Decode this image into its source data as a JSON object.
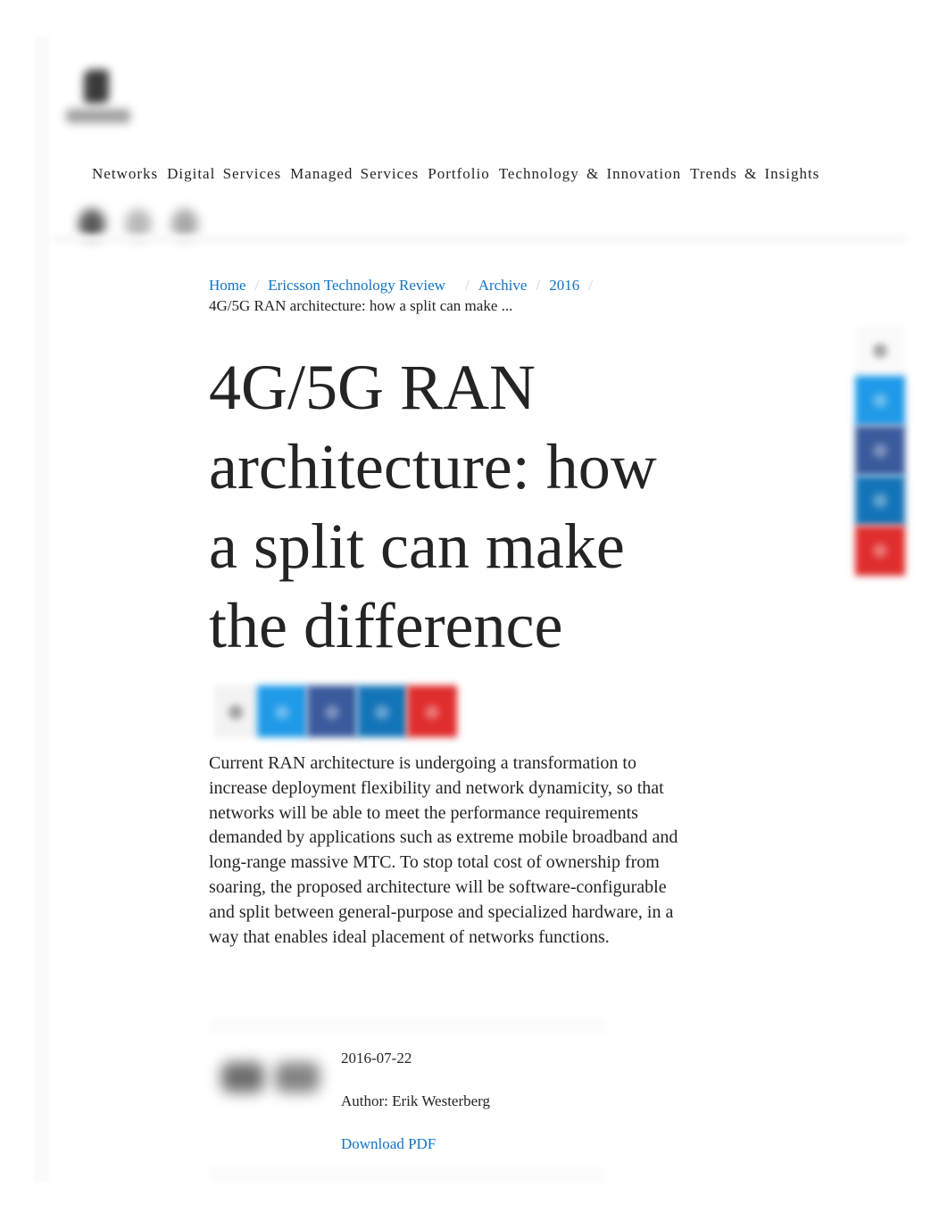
{
  "header": {
    "logo_icon": "ericsson-logo-icon",
    "nav": [
      {
        "label": "Networks"
      },
      {
        "label": "Digital Services"
      },
      {
        "label": "Managed Services"
      },
      {
        "label": "Portfolio"
      },
      {
        "label": "Technology & Innovation"
      },
      {
        "label": "Trends & Insights"
      }
    ],
    "icons": [
      "user-icon",
      "search-icon",
      "menu-icon"
    ]
  },
  "breadcrumb": {
    "items": [
      {
        "label": "Home"
      },
      {
        "label": "Ericsson Technology Review"
      },
      {
        "label": "Archive"
      },
      {
        "label": "2016"
      }
    ],
    "separator": "/",
    "current": "4G/5G RAN architecture: how a split can make ..."
  },
  "article": {
    "title": "4G/5G RAN architecture: how a split can make the difference",
    "intro": "Current RAN architecture is undergoing a transformation to increase deployment flexibility and network dynamicity, so that networks will be able to meet the performance requirements demanded by applications such as extreme mobile broadband and long-range massive MTC. To stop total cost of ownership from soaring, the proposed architecture will be software-configurable and split between general-purpose and specialized hardware, in a way that enables ideal placement of networks functions.",
    "date": "2016-07-22",
    "author": "Author: Erik Westerberg",
    "download_label": "Download PDF"
  },
  "share": {
    "buttons": [
      {
        "name": "email",
        "icon": "email-icon"
      },
      {
        "name": "twitter",
        "icon": "twitter-icon",
        "color": "#1f9ae8"
      },
      {
        "name": "facebook",
        "icon": "facebook-icon",
        "color": "#3a5a9c"
      },
      {
        "name": "linkedin",
        "icon": "linkedin-icon",
        "color": "#1474b8"
      },
      {
        "name": "pinterest",
        "icon": "pinterest-icon",
        "color": "#e02d2d"
      }
    ]
  },
  "colors": {
    "link": "#1174c6",
    "text": "#242424"
  }
}
